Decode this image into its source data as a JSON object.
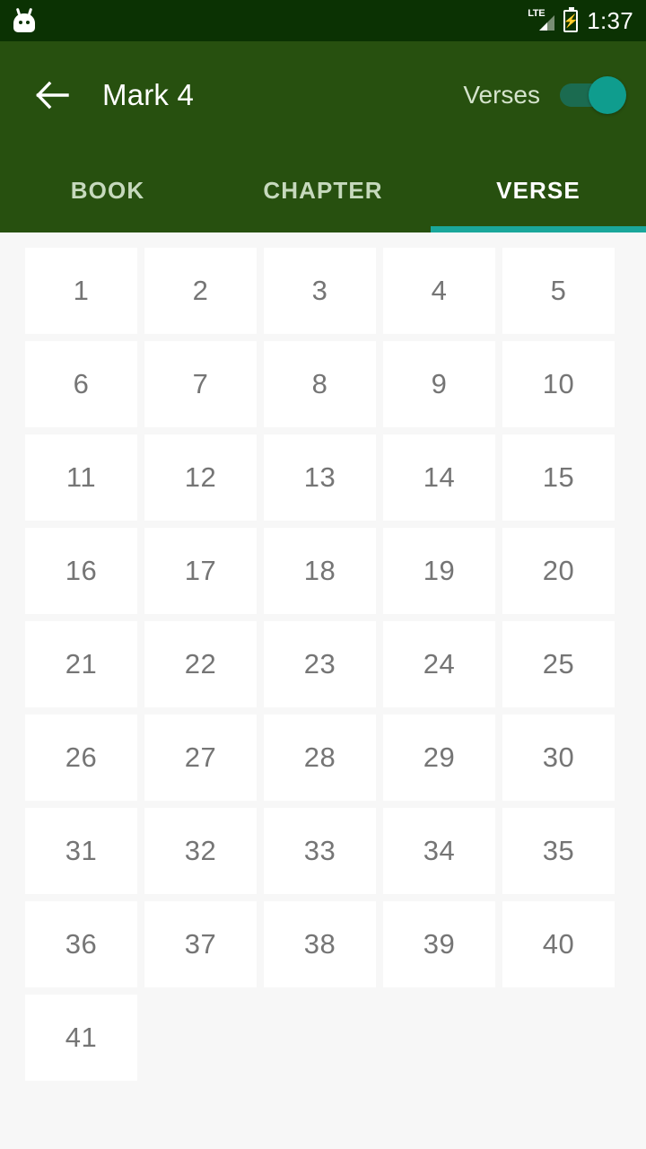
{
  "status_bar": {
    "left_icon": "android-head-icon",
    "network_label": "LTE",
    "signal_icon": "signal-triangle-icon",
    "battery_icon": "battery-charging-icon",
    "battery_glyph": "⚡",
    "time": "1:37",
    "background_color": "#0b3203"
  },
  "app_bar": {
    "back_icon": "back-arrow-icon",
    "title": "Mark 4",
    "toggle_label": "Verses",
    "toggle_state": "on",
    "background_color": "#27500f",
    "accent_color": "#0f9d8e"
  },
  "tabs": {
    "items": [
      {
        "label": "BOOK",
        "active": false
      },
      {
        "label": "CHAPTER",
        "active": false
      },
      {
        "label": "VERSE",
        "active": true
      }
    ],
    "indicator_color": "#1aa79b"
  },
  "grid": {
    "columns": 5,
    "cell_background": "#ffffff",
    "cell_text_color": "#757575",
    "background_color": "#f7f7f7",
    "verses": [
      "1",
      "2",
      "3",
      "4",
      "5",
      "6",
      "7",
      "8",
      "9",
      "10",
      "11",
      "12",
      "13",
      "14",
      "15",
      "16",
      "17",
      "18",
      "19",
      "20",
      "21",
      "22",
      "23",
      "24",
      "25",
      "26",
      "27",
      "28",
      "29",
      "30",
      "31",
      "32",
      "33",
      "34",
      "35",
      "36",
      "37",
      "38",
      "39",
      "40",
      "41"
    ]
  }
}
